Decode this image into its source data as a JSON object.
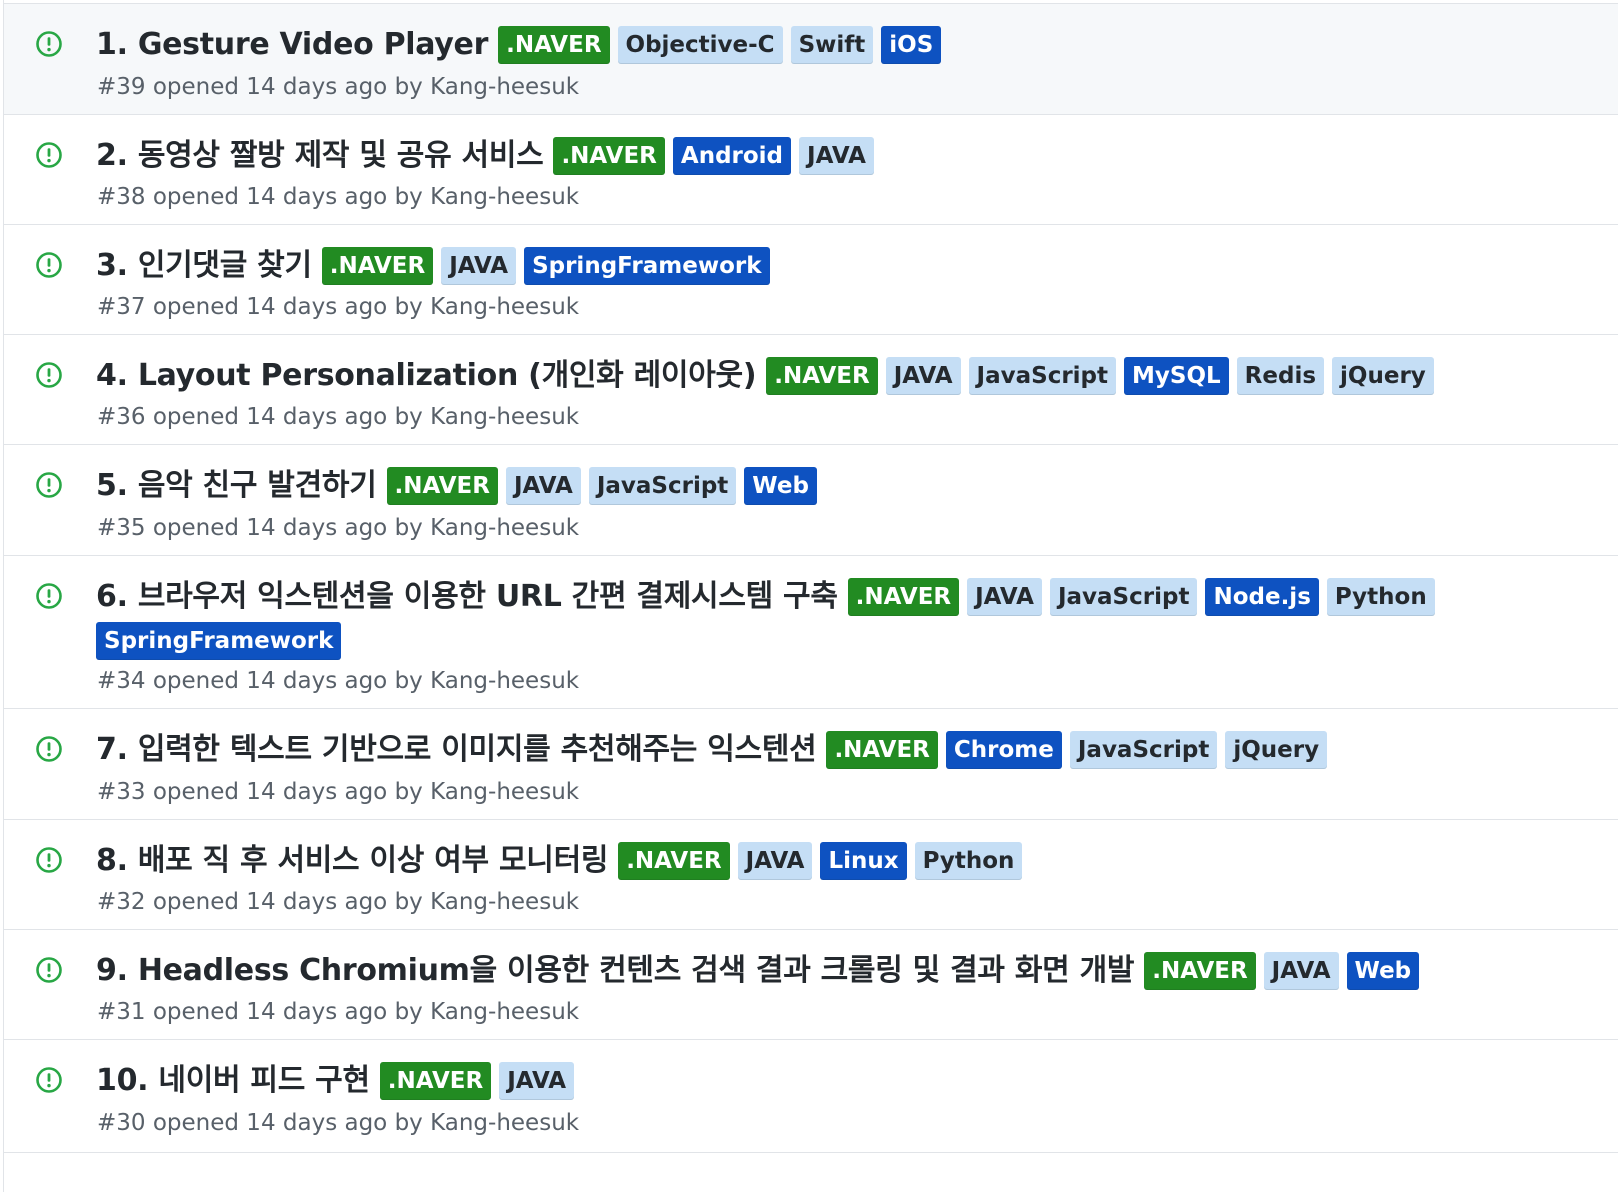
{
  "colors": {
    "naver": "#228b22",
    "light": "#c5def5",
    "blue": "#0e52c1",
    "open_icon": "#28a745",
    "meta_text": "#586069"
  },
  "issues": [
    {
      "title": "1. Gesture Video Player",
      "meta": "#39 opened 14 days ago by Kang-heesuk",
      "labels": [
        {
          "text": ".NAVER",
          "style": "naver"
        },
        {
          "text": "Objective-C",
          "style": "light"
        },
        {
          "text": "Swift",
          "style": "light"
        },
        {
          "text": "iOS",
          "style": "blue"
        }
      ]
    },
    {
      "title": "2. 동영상 짤방 제작 및 공유 서비스",
      "meta": "#38 opened 14 days ago by Kang-heesuk",
      "labels": [
        {
          "text": ".NAVER",
          "style": "naver"
        },
        {
          "text": "Android",
          "style": "blue"
        },
        {
          "text": "JAVA",
          "style": "light"
        }
      ]
    },
    {
      "title": "3. 인기댓글 찾기",
      "meta": "#37 opened 14 days ago by Kang-heesuk",
      "labels": [
        {
          "text": ".NAVER",
          "style": "naver"
        },
        {
          "text": "JAVA",
          "style": "light"
        },
        {
          "text": "SpringFramework",
          "style": "blue"
        }
      ]
    },
    {
      "title": "4. Layout Personalization (개인화 레이아웃)",
      "meta": "#36 opened 14 days ago by Kang-heesuk",
      "labels": [
        {
          "text": ".NAVER",
          "style": "naver"
        },
        {
          "text": "JAVA",
          "style": "light"
        },
        {
          "text": "JavaScript",
          "style": "light"
        },
        {
          "text": "MySQL",
          "style": "blue"
        },
        {
          "text": "Redis",
          "style": "light"
        },
        {
          "text": "jQuery",
          "style": "light"
        }
      ]
    },
    {
      "title": "5. 음악 친구 발견하기",
      "meta": "#35 opened 14 days ago by Kang-heesuk",
      "labels": [
        {
          "text": ".NAVER",
          "style": "naver"
        },
        {
          "text": "JAVA",
          "style": "light"
        },
        {
          "text": "JavaScript",
          "style": "light"
        },
        {
          "text": "Web",
          "style": "blue"
        }
      ]
    },
    {
      "title": "6. 브라우저 익스텐션을 이용한 URL 간편 결제시스템 구축",
      "meta": "#34 opened 14 days ago by Kang-heesuk",
      "labels": [
        {
          "text": ".NAVER",
          "style": "naver"
        },
        {
          "text": "JAVA",
          "style": "light"
        },
        {
          "text": "JavaScript",
          "style": "light"
        },
        {
          "text": "Node.js",
          "style": "blue"
        },
        {
          "text": "Python",
          "style": "light"
        },
        {
          "text": "SpringFramework",
          "style": "blue"
        }
      ]
    },
    {
      "title": "7. 입력한 텍스트 기반으로 이미지를 추천해주는 익스텐션",
      "meta": "#33 opened 14 days ago by Kang-heesuk",
      "labels": [
        {
          "text": ".NAVER",
          "style": "naver"
        },
        {
          "text": "Chrome",
          "style": "blue"
        },
        {
          "text": "JavaScript",
          "style": "light"
        },
        {
          "text": "jQuery",
          "style": "light"
        }
      ]
    },
    {
      "title": "8. 배포 직 후 서비스 이상 여부 모니터링",
      "meta": "#32 opened 14 days ago by Kang-heesuk",
      "labels": [
        {
          "text": ".NAVER",
          "style": "naver"
        },
        {
          "text": "JAVA",
          "style": "light"
        },
        {
          "text": "Linux",
          "style": "blue"
        },
        {
          "text": "Python",
          "style": "light"
        }
      ]
    },
    {
      "title": "9. Headless Chromium을 이용한 컨텐츠 검색 결과 크롤링 및 결과 화면 개발",
      "meta": "#31 opened 14 days ago by Kang-heesuk",
      "labels": [
        {
          "text": ".NAVER",
          "style": "naver"
        },
        {
          "text": "JAVA",
          "style": "light"
        },
        {
          "text": "Web",
          "style": "blue"
        }
      ]
    },
    {
      "title": "10. 네이버 피드 구현",
      "meta": "#30 opened 14 days ago by Kang-heesuk",
      "labels": [
        {
          "text": ".NAVER",
          "style": "naver"
        },
        {
          "text": "JAVA",
          "style": "light"
        }
      ]
    }
  ]
}
